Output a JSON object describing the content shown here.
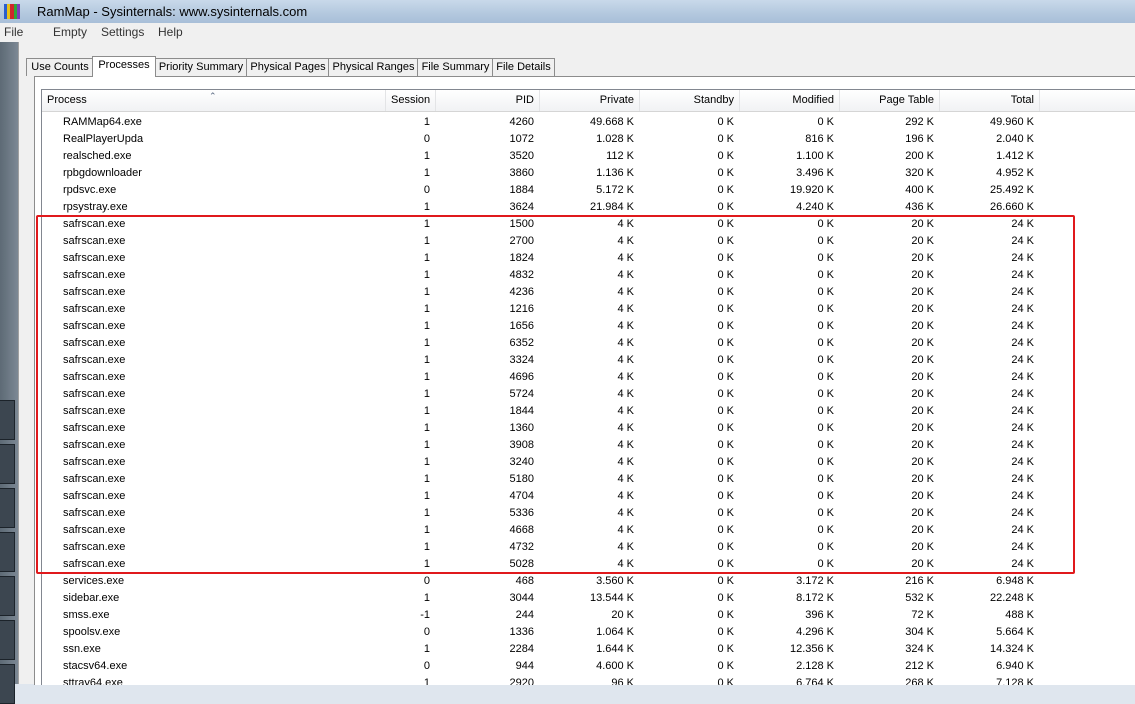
{
  "window": {
    "title": "RamMap - Sysinternals: www.sysinternals.com"
  },
  "menu": [
    "File",
    "Empty",
    "Settings",
    "Help"
  ],
  "tabs": [
    {
      "label": "Use Counts",
      "active": false
    },
    {
      "label": "Processes",
      "active": true
    },
    {
      "label": "Priority Summary",
      "active": false
    },
    {
      "label": "Physical Pages",
      "active": false
    },
    {
      "label": "Physical Ranges",
      "active": false
    },
    {
      "label": "File Summary",
      "active": false
    },
    {
      "label": "File Details",
      "active": false
    }
  ],
  "columns": [
    "Process",
    "Session",
    "PID",
    "Private",
    "Standby",
    "Modified",
    "Page Table",
    "Total"
  ],
  "rows": [
    [
      "RAMMap64.exe",
      "1",
      "4260",
      "49.668 K",
      "0 K",
      "0 K",
      "292 K",
      "49.960 K"
    ],
    [
      "RealPlayerUpda",
      "0",
      "1072",
      "1.028 K",
      "0 K",
      "816 K",
      "196 K",
      "2.040 K"
    ],
    [
      "realsched.exe",
      "1",
      "3520",
      "112 K",
      "0 K",
      "1.100 K",
      "200 K",
      "1.412 K"
    ],
    [
      "rpbgdownloader",
      "1",
      "3860",
      "1.136 K",
      "0 K",
      "3.496 K",
      "320 K",
      "4.952 K"
    ],
    [
      "rpdsvc.exe",
      "0",
      "1884",
      "5.172 K",
      "0 K",
      "19.920 K",
      "400 K",
      "25.492 K"
    ],
    [
      "rpsystray.exe",
      "1",
      "3624",
      "21.984 K",
      "0 K",
      "4.240 K",
      "436 K",
      "26.660 K"
    ],
    [
      "safrscan.exe",
      "1",
      "1500",
      "4 K",
      "0 K",
      "0 K",
      "20 K",
      "24 K"
    ],
    [
      "safrscan.exe",
      "1",
      "2700",
      "4 K",
      "0 K",
      "0 K",
      "20 K",
      "24 K"
    ],
    [
      "safrscan.exe",
      "1",
      "1824",
      "4 K",
      "0 K",
      "0 K",
      "20 K",
      "24 K"
    ],
    [
      "safrscan.exe",
      "1",
      "4832",
      "4 K",
      "0 K",
      "0 K",
      "20 K",
      "24 K"
    ],
    [
      "safrscan.exe",
      "1",
      "4236",
      "4 K",
      "0 K",
      "0 K",
      "20 K",
      "24 K"
    ],
    [
      "safrscan.exe",
      "1",
      "1216",
      "4 K",
      "0 K",
      "0 K",
      "20 K",
      "24 K"
    ],
    [
      "safrscan.exe",
      "1",
      "1656",
      "4 K",
      "0 K",
      "0 K",
      "20 K",
      "24 K"
    ],
    [
      "safrscan.exe",
      "1",
      "6352",
      "4 K",
      "0 K",
      "0 K",
      "20 K",
      "24 K"
    ],
    [
      "safrscan.exe",
      "1",
      "3324",
      "4 K",
      "0 K",
      "0 K",
      "20 K",
      "24 K"
    ],
    [
      "safrscan.exe",
      "1",
      "4696",
      "4 K",
      "0 K",
      "0 K",
      "20 K",
      "24 K"
    ],
    [
      "safrscan.exe",
      "1",
      "5724",
      "4 K",
      "0 K",
      "0 K",
      "20 K",
      "24 K"
    ],
    [
      "safrscan.exe",
      "1",
      "1844",
      "4 K",
      "0 K",
      "0 K",
      "20 K",
      "24 K"
    ],
    [
      "safrscan.exe",
      "1",
      "1360",
      "4 K",
      "0 K",
      "0 K",
      "20 K",
      "24 K"
    ],
    [
      "safrscan.exe",
      "1",
      "3908",
      "4 K",
      "0 K",
      "0 K",
      "20 K",
      "24 K"
    ],
    [
      "safrscan.exe",
      "1",
      "3240",
      "4 K",
      "0 K",
      "0 K",
      "20 K",
      "24 K"
    ],
    [
      "safrscan.exe",
      "1",
      "5180",
      "4 K",
      "0 K",
      "0 K",
      "20 K",
      "24 K"
    ],
    [
      "safrscan.exe",
      "1",
      "4704",
      "4 K",
      "0 K",
      "0 K",
      "20 K",
      "24 K"
    ],
    [
      "safrscan.exe",
      "1",
      "5336",
      "4 K",
      "0 K",
      "0 K",
      "20 K",
      "24 K"
    ],
    [
      "safrscan.exe",
      "1",
      "4668",
      "4 K",
      "0 K",
      "0 K",
      "20 K",
      "24 K"
    ],
    [
      "safrscan.exe",
      "1",
      "4732",
      "4 K",
      "0 K",
      "0 K",
      "20 K",
      "24 K"
    ],
    [
      "safrscan.exe",
      "1",
      "5028",
      "4 K",
      "0 K",
      "0 K",
      "20 K",
      "24 K"
    ],
    [
      "services.exe",
      "0",
      "468",
      "3.560 K",
      "0 K",
      "3.172 K",
      "216 K",
      "6.948 K"
    ],
    [
      "sidebar.exe",
      "1",
      "3044",
      "13.544 K",
      "0 K",
      "8.172 K",
      "532 K",
      "22.248 K"
    ],
    [
      "smss.exe",
      "-1",
      "244",
      "20 K",
      "0 K",
      "396 K",
      "72 K",
      "488 K"
    ],
    [
      "spoolsv.exe",
      "0",
      "1336",
      "1.064 K",
      "0 K",
      "4.296 K",
      "304 K",
      "5.664 K"
    ],
    [
      "ssn.exe",
      "1",
      "2284",
      "1.644 K",
      "0 K",
      "12.356 K",
      "324 K",
      "14.324 K"
    ],
    [
      "stacsv64.exe",
      "0",
      "944",
      "4.600 K",
      "0 K",
      "2.128 K",
      "212 K",
      "6.940 K"
    ],
    [
      "sttray64.exe",
      "1",
      "2920",
      "96 K",
      "0 K",
      "6.764 K",
      "268 K",
      "7.128 K"
    ]
  ],
  "colors": {
    "highlight_border": "#e0191c",
    "title_bar": "#b3c8de"
  },
  "icons": {
    "app": "rammap-icon",
    "sort": "sort-ascending-icon"
  }
}
